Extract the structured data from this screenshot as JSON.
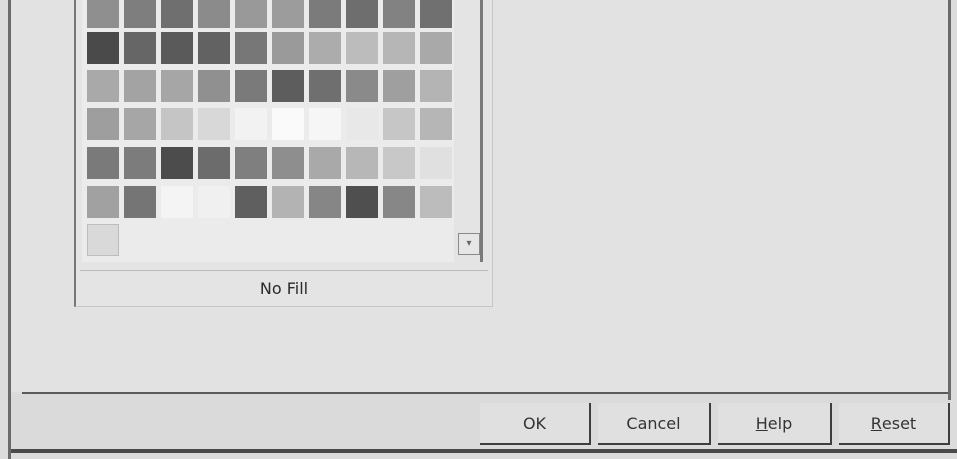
{
  "palette": {
    "no_fill_label": "No Fill",
    "rows": [
      [
        "#8f8f8f",
        "#7e7e7e",
        "#6f6f6f",
        "#8b8b8b",
        "#999999",
        "#9c9c9c",
        "#7b7b7b",
        "#6e6e6e",
        "#828282",
        "#707070"
      ],
      [
        "#4a4a4a",
        "#666666",
        "#5a5a5a",
        "#626262",
        "#777777",
        "#9a9a9a",
        "#acacac",
        "#bcbcbc",
        "#b6b6b6",
        "#a9a9a9"
      ],
      [
        "#a9a9a9",
        "#a3a3a3",
        "#a6a6a6",
        "#909090",
        "#7a7a7a",
        "#5d5d5d",
        "#6f6f6f",
        "#8a8a8a",
        "#9f9f9f",
        "#b4b4b4"
      ],
      [
        "#9e9e9e",
        "#a6a6a6",
        "#c5c5c5",
        "#d8d8d8",
        "#f2f2f2",
        "#fafafa",
        "#f6f6f6",
        "#e8e8e8",
        "#c6c6c6",
        "#b6b6b6"
      ],
      [
        "#7a7a7a",
        "#7c7c7c",
        "#4c4c4c",
        "#6c6c6c",
        "#7f7f7f",
        "#8e8e8e",
        "#a9a9a9",
        "#b7b7b7",
        "#c8c8c8",
        "#e0e0e0"
      ],
      [
        "#a1a1a1",
        "#757575",
        "#f4f4f4",
        "#f0f0f0",
        "#5f5f5f",
        "#b3b3b3",
        "#868686",
        "#4f4f4f",
        "#878787",
        "#bcbcbc"
      ],
      [
        "#d9d9d9"
      ]
    ]
  },
  "buttons": {
    "ok": "OK",
    "cancel": "Cancel",
    "help_mnemonic": "H",
    "help_rest": "elp",
    "reset_mnemonic": "R",
    "reset_rest": "eset"
  },
  "scroll": {
    "arrow_glyph": "▾"
  }
}
